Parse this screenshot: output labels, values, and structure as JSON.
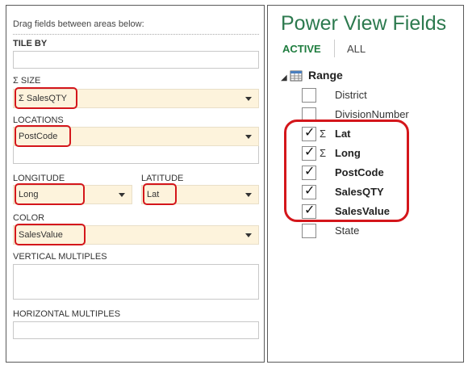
{
  "left_panel": {
    "hint": "Drag fields between areas below:",
    "tile_by": {
      "label": "TILE BY",
      "value": ""
    },
    "size": {
      "label": "SIZE",
      "value": "SalesQTY"
    },
    "locations": {
      "label": "LOCATIONS",
      "value": "PostCode"
    },
    "longitude": {
      "label": "LONGITUDE",
      "value": "Long"
    },
    "latitude": {
      "label": "LATITUDE",
      "value": "Lat"
    },
    "color": {
      "label": "COLOR",
      "value": "SalesValue"
    },
    "vertical_multiples": {
      "label": "VERTICAL MULTIPLES",
      "value": ""
    },
    "horizontal_multiples": {
      "label": "HORIZONTAL MULTIPLES",
      "value": ""
    }
  },
  "right_panel": {
    "title": "Power View Fields",
    "tabs": {
      "active": "ACTIVE",
      "all": "ALL"
    },
    "table": "Range",
    "fields": [
      {
        "name": "District",
        "checked": false,
        "sigma": false
      },
      {
        "name": "DivisionNumber",
        "checked": false,
        "sigma": false
      },
      {
        "name": "Lat",
        "checked": true,
        "sigma": true
      },
      {
        "name": "Long",
        "checked": true,
        "sigma": true
      },
      {
        "name": "PostCode",
        "checked": true,
        "sigma": false
      },
      {
        "name": "SalesQTY",
        "checked": true,
        "sigma": false
      },
      {
        "name": "SalesValue",
        "checked": true,
        "sigma": false
      },
      {
        "name": "State",
        "checked": false,
        "sigma": false
      }
    ]
  },
  "symbols": {
    "sigma": "Σ",
    "check": "✓"
  },
  "colors": {
    "highlight": "#d4161b",
    "accent": "#2d7a4f",
    "well": "#fdf3dc"
  }
}
